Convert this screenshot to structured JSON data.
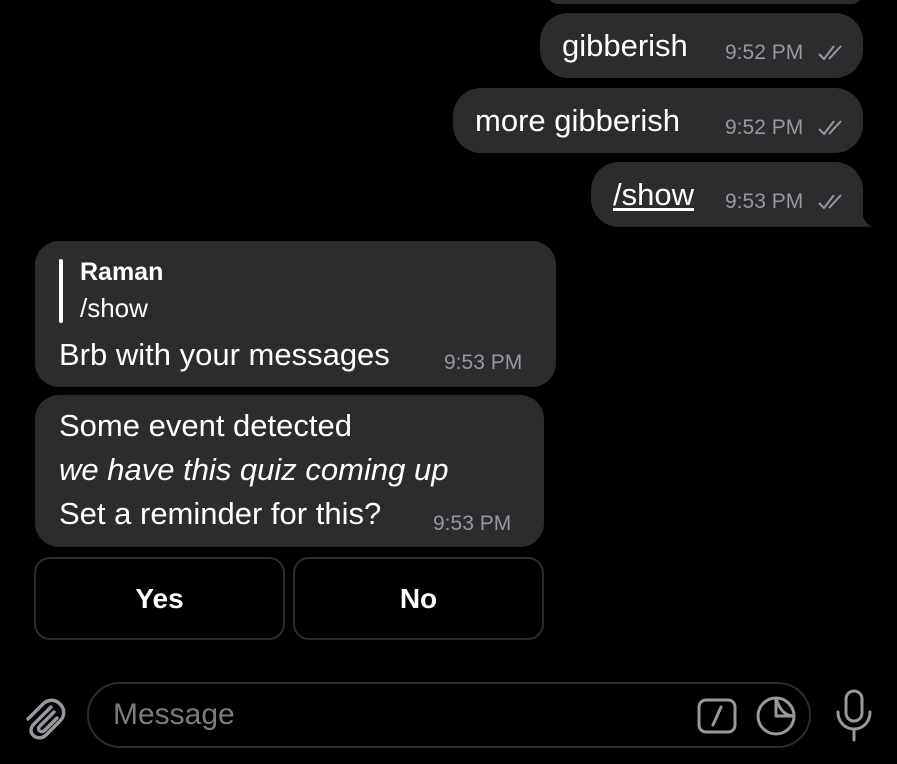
{
  "messages": {
    "outgoing": [
      {
        "text": "gibberish",
        "time": "9:52 PM",
        "status": "read"
      },
      {
        "text": "more gibberish",
        "time": "9:52 PM",
        "status": "read"
      },
      {
        "text": "/show",
        "time": "9:53 PM",
        "status": "read"
      }
    ],
    "reply": {
      "quote_author": "Raman",
      "quote_text": "/show",
      "text": "Brb with your messages",
      "time": "9:53 PM"
    },
    "event": {
      "line1": "Some event detected",
      "line2": "we have this quiz coming up",
      "line3": "Set a reminder for this?",
      "time": "9:53 PM"
    }
  },
  "keyboard": {
    "buttons": [
      "Yes",
      "No"
    ]
  },
  "composer": {
    "placeholder": "Message",
    "icons": [
      "attach-icon",
      "commands-icon",
      "sticker-icon",
      "microphone-icon"
    ]
  },
  "colors": {
    "background": "#000000",
    "bubble": "#2c2c2e",
    "meta_text": "#98989e",
    "placeholder": "#7c7c80"
  }
}
